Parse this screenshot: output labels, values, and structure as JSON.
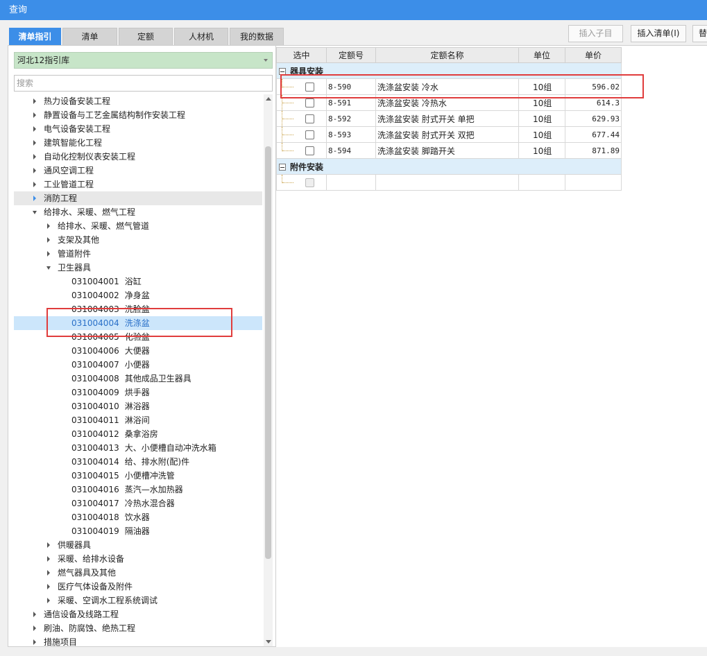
{
  "window": {
    "title": "查询"
  },
  "tabs": [
    {
      "label": "清单指引",
      "active": true
    },
    {
      "label": "清单"
    },
    {
      "label": "定额"
    },
    {
      "label": "人材机"
    },
    {
      "label": "我的数据"
    }
  ],
  "toolbar": {
    "insert_child": "插入子目",
    "insert_list": "插入清单(I)",
    "replace": "替"
  },
  "left": {
    "library": "河北12指引库",
    "search_placeholder": "搜索",
    "tree": [
      {
        "label": "热力设备安装工程"
      },
      {
        "label": "静置设备与工艺金属结构制作安装工程"
      },
      {
        "label": "电气设备安装工程"
      },
      {
        "label": "建筑智能化工程"
      },
      {
        "label": "自动化控制仪表安装工程"
      },
      {
        "label": "通风空调工程"
      },
      {
        "label": "工业管道工程"
      },
      {
        "label": "消防工程"
      },
      {
        "label": "给排水、采暖、燃气工程"
      },
      {
        "label": "给排水、采暖、燃气管道"
      },
      {
        "label": "支架及其他"
      },
      {
        "label": "管道附件"
      },
      {
        "label": "卫生器具"
      },
      {
        "code": "031004001",
        "label": "浴缸"
      },
      {
        "code": "031004002",
        "label": "净身盆"
      },
      {
        "code": "031004003",
        "label": "洗脸盆"
      },
      {
        "code": "031004004",
        "label": "洗涤盆"
      },
      {
        "code": "031004005",
        "label": "化验盆"
      },
      {
        "code": "031004006",
        "label": "大便器"
      },
      {
        "code": "031004007",
        "label": "小便器"
      },
      {
        "code": "031004008",
        "label": "其他成品卫生器具"
      },
      {
        "code": "031004009",
        "label": "烘手器"
      },
      {
        "code": "031004010",
        "label": "淋浴器"
      },
      {
        "code": "031004011",
        "label": "淋浴间"
      },
      {
        "code": "031004012",
        "label": "桑拿浴房"
      },
      {
        "code": "031004013",
        "label": "大、小便槽自动冲洗水箱"
      },
      {
        "code": "031004014",
        "label": "给、排水附(配)件"
      },
      {
        "code": "031004015",
        "label": "小便槽冲洗管"
      },
      {
        "code": "031004016",
        "label": "蒸汽—水加热器"
      },
      {
        "code": "031004017",
        "label": "冷热水混合器"
      },
      {
        "code": "031004018",
        "label": "饮水器"
      },
      {
        "code": "031004019",
        "label": "隔油器"
      },
      {
        "label": "供暖器具"
      },
      {
        "label": "采暖、给排水设备"
      },
      {
        "label": "燃气器具及其他"
      },
      {
        "label": "医疗气体设备及附件"
      },
      {
        "label": "采暖、空调水工程系统调试"
      },
      {
        "label": "通信设备及线路工程"
      },
      {
        "label": "刷油、防腐蚀、绝热工程"
      },
      {
        "label": "措施项目"
      }
    ]
  },
  "grid": {
    "headers": [
      "选中",
      "定额号",
      "定额名称",
      "单位",
      "单价"
    ],
    "groups": [
      {
        "title": "器具安装",
        "rows": [
          {
            "code": "8-590",
            "name": "洗涤盆安装 冷水",
            "unit": "10组",
            "price": "596.02"
          },
          {
            "code": "8-591",
            "name": "洗涤盆安装 冷热水",
            "unit": "10组",
            "price": "614.3"
          },
          {
            "code": "8-592",
            "name": "洗涤盆安装 肘式开关 单把",
            "unit": "10组",
            "price": "629.93"
          },
          {
            "code": "8-593",
            "name": "洗涤盆安装 肘式开关 双把",
            "unit": "10组",
            "price": "677.44"
          },
          {
            "code": "8-594",
            "name": "洗涤盆安装 脚踏开关",
            "unit": "10组",
            "price": "871.89"
          }
        ]
      },
      {
        "title": "附件安装",
        "rows": []
      }
    ]
  }
}
